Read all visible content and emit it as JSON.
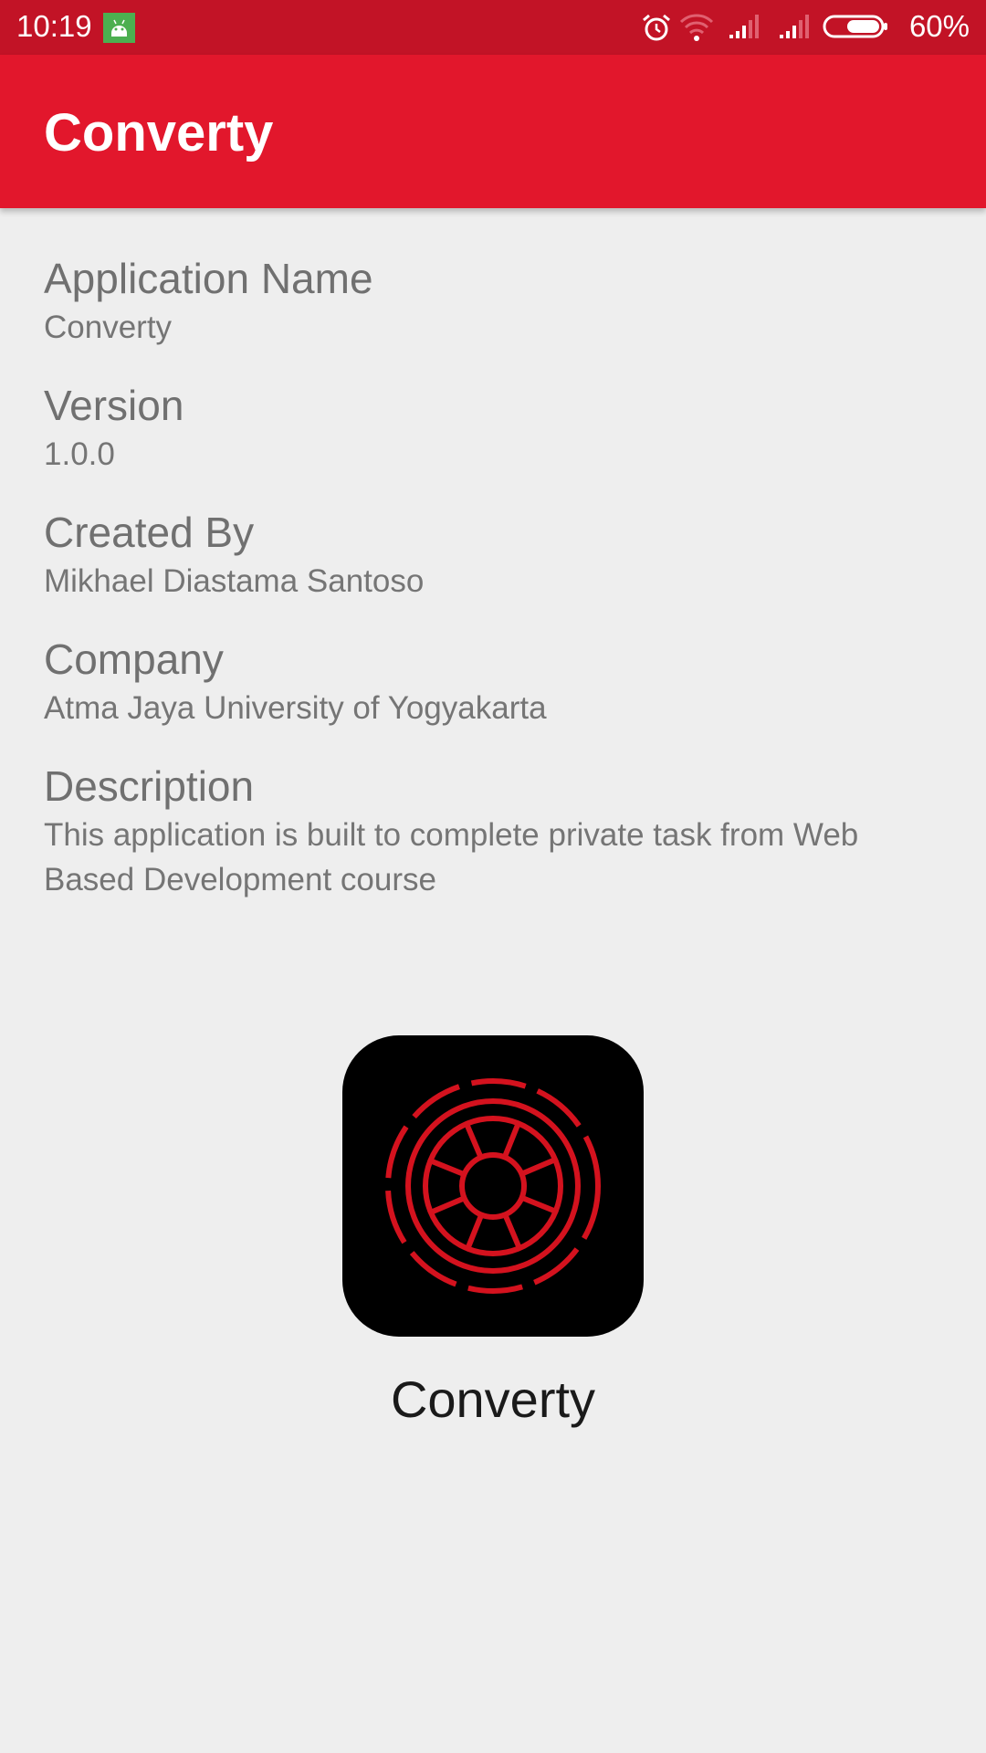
{
  "status_bar": {
    "time": "10:19",
    "battery_percent": "60%",
    "icons": [
      "android-notification-icon",
      "alarm-icon",
      "wifi-icon",
      "signal-icon",
      "signal-icon",
      "battery-icon"
    ]
  },
  "app_bar": {
    "title": "Converty"
  },
  "info": {
    "application_name": {
      "label": "Application Name",
      "value": "Converty"
    },
    "version": {
      "label": "Version",
      "value": "1.0.0"
    },
    "created_by": {
      "label": "Created By",
      "value": "Mikhael Diastama Santoso"
    },
    "company": {
      "label": "Company",
      "value": "Atma Jaya University of Yogyakarta"
    },
    "description": {
      "label": "Description",
      "value": "This application is built to complete private task from Web Based Development course"
    }
  },
  "logo": {
    "icon": "wheel-logo-icon",
    "caption": "Converty"
  },
  "colors": {
    "status_bar": "#c21326",
    "app_bar": "#e2172c",
    "logo_red": "#d4121e",
    "background": "#eeeeee"
  }
}
